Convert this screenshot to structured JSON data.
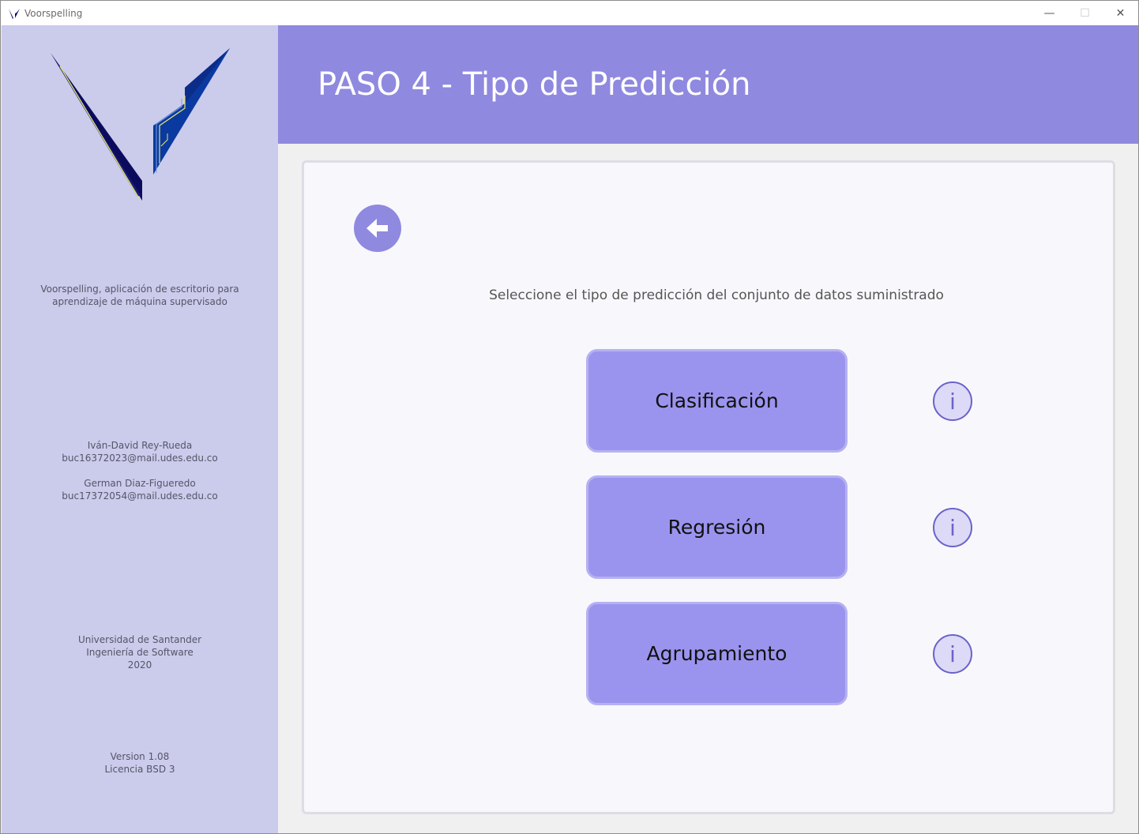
{
  "window": {
    "title": "Voorspelling",
    "minimize": "—",
    "maximize": "☐",
    "close": "✕"
  },
  "sidebar": {
    "description": [
      "Voorspelling, aplicación de escritorio para",
      "aprendizaje de máquina supervisado"
    ],
    "author1": {
      "name": "Iván-David Rey-Rueda",
      "email": "buc16372023@mail.udes.edu.co"
    },
    "author2": {
      "name": "German Diaz-Figueredo",
      "email": "buc17372054@mail.udes.edu.co"
    },
    "institution": [
      "Universidad de Santander",
      "Ingeniería de Software",
      "2020"
    ],
    "version": [
      "Version 1.08",
      "Licencia BSD 3"
    ]
  },
  "header": {
    "title": "PASO 4 - Tipo de Predicción"
  },
  "main": {
    "instruction": "Seleccione el tipo de predicción del conjunto de datos suministrado",
    "options": [
      {
        "label": "Clasificación",
        "info": "i"
      },
      {
        "label": "Regresión",
        "info": "i"
      },
      {
        "label": "Agrupamiento",
        "info": "i"
      }
    ]
  },
  "colors": {
    "header": "#8f89e0",
    "sidebar": "#cbcbec",
    "button": "#9b94ee",
    "accent": "#6a63c9"
  },
  "icons": [
    "voorspelling-logo",
    "back-arrow-icon",
    "info-icon"
  ]
}
